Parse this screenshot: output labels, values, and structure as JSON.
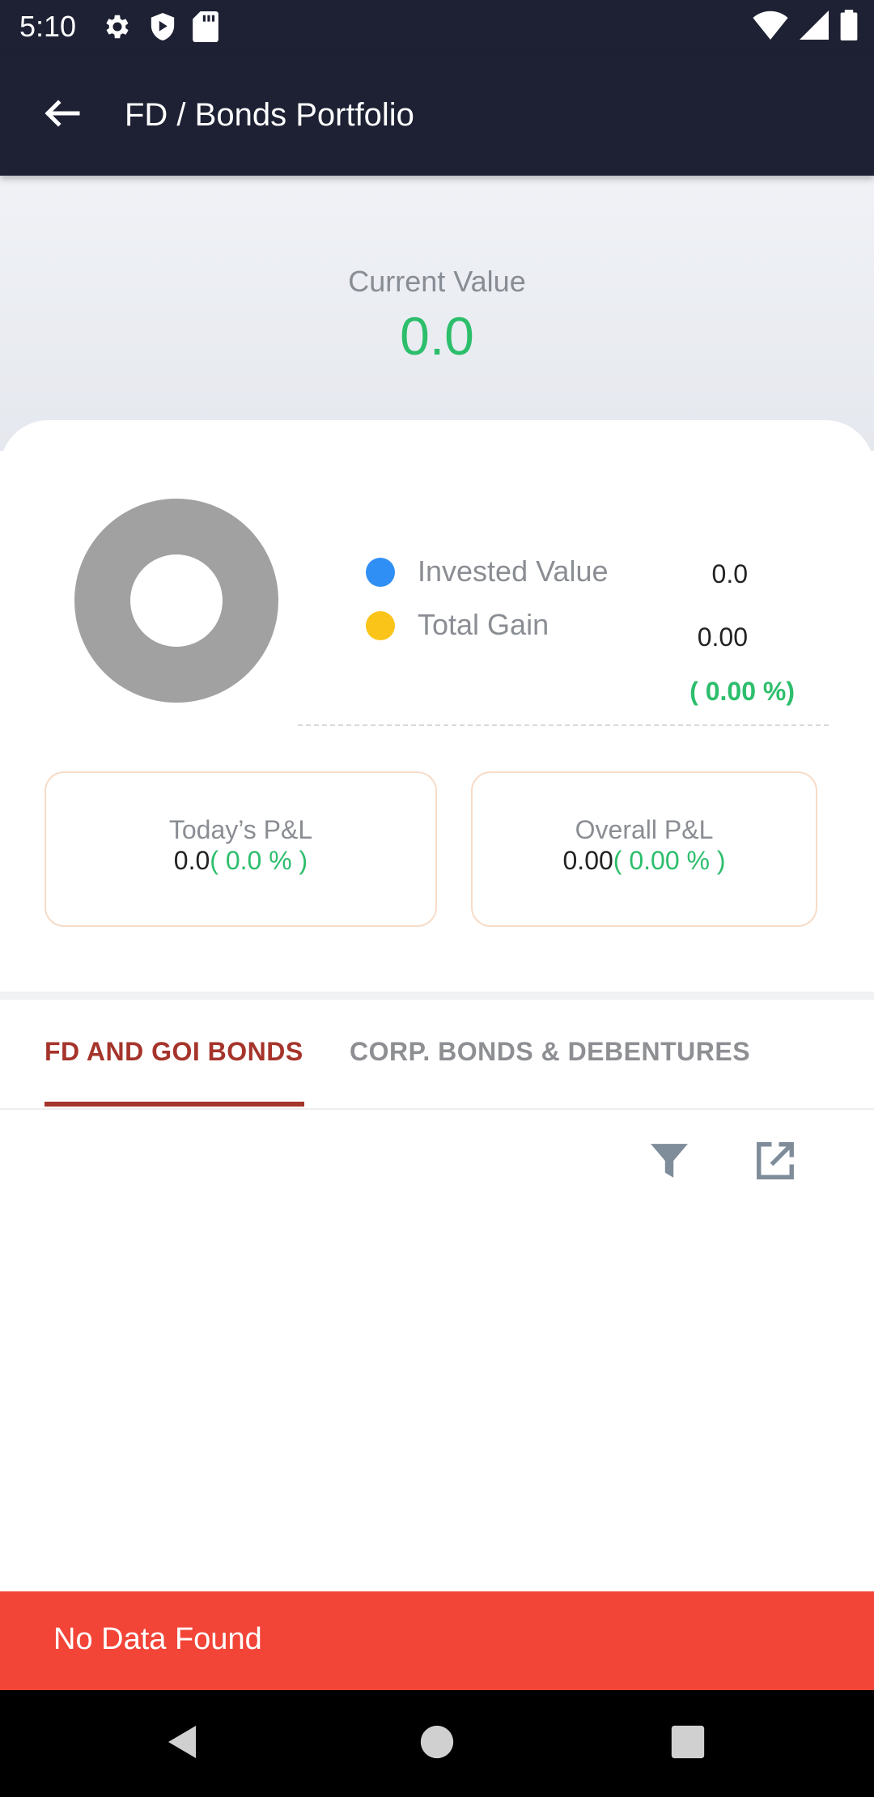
{
  "status_bar": {
    "time": "5:10",
    "left_icons": [
      "settings-icon",
      "shield-icon",
      "sd-card-icon"
    ],
    "right_icons": [
      "wifi-icon",
      "cell-signal-icon",
      "battery-icon"
    ]
  },
  "app_bar": {
    "title": "FD / Bonds Portfolio",
    "back_icon": "arrow-left-icon"
  },
  "hero": {
    "label": "Current Value",
    "value": "0.0"
  },
  "summary": {
    "legend": [
      {
        "label": "Invested Value",
        "value": "0.0",
        "color": "#2f8ff5"
      },
      {
        "label": "Total Gain",
        "value": "0.00",
        "color": "#fbc419"
      }
    ],
    "gain_percent": "( 0.00 %)",
    "todays_pl": {
      "title": "Today’s P&L",
      "value": "0.0",
      "percent": "( 0.0 % )"
    },
    "overall_pl": {
      "title": "Overall P&L",
      "value": "0.00",
      "percent": "( 0.00 % )"
    }
  },
  "tabs": [
    {
      "label": "FD AND GOI BONDS",
      "active": true
    },
    {
      "label": "CORP. BONDS & DEBENTURES",
      "active": false
    }
  ],
  "toolbar": {
    "filter_icon": "filter-icon",
    "export_icon": "open-external-icon"
  },
  "snackbar": {
    "message": "No Data Found"
  },
  "nav_bar": {
    "icons": [
      "nav-back-icon",
      "nav-home-icon",
      "nav-recents-icon"
    ]
  },
  "colors": {
    "app_bar": "#1d2133",
    "positive": "#2dbe6c",
    "accent_tab": "#a5342b",
    "snackbar": "#f24437",
    "donut": "#a1a1a1"
  }
}
